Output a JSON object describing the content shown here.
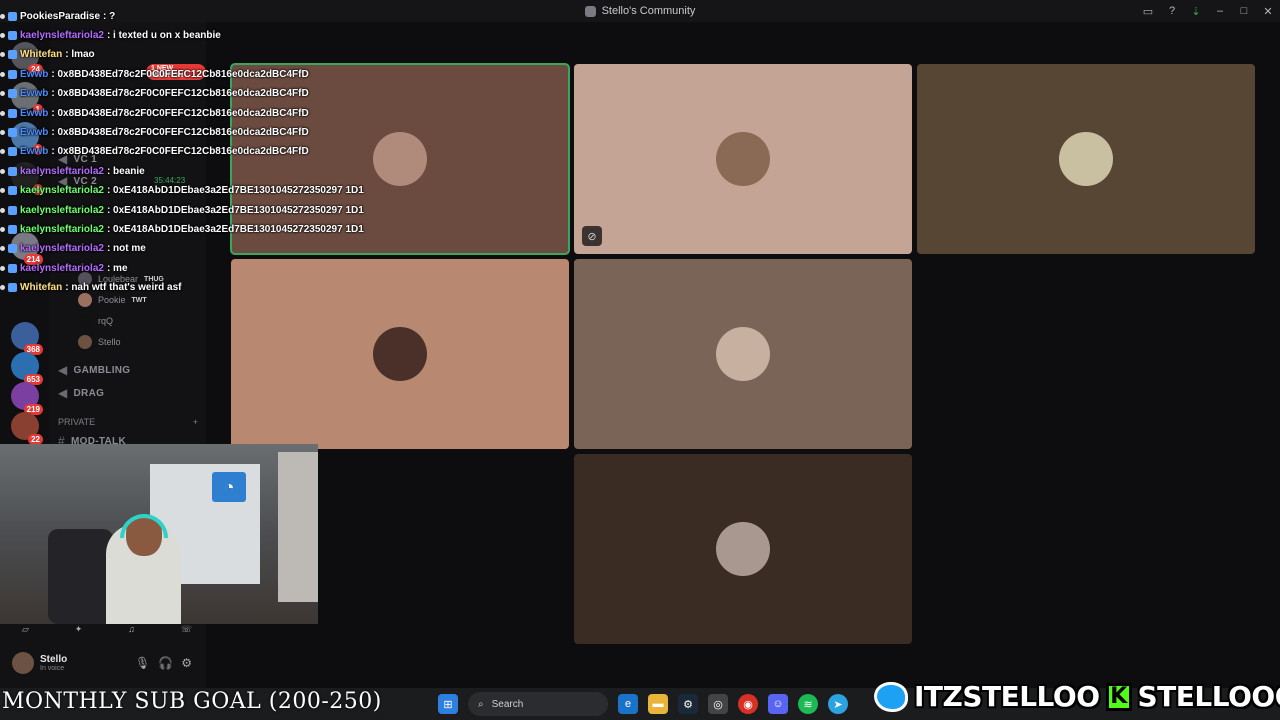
{
  "window": {
    "title": "Stello's Community"
  },
  "server_badges": [
    "24",
    "1",
    "1",
    "4",
    "214",
    "368",
    "653",
    "219",
    "22"
  ],
  "sidebar": {
    "new_mention": "1 NEW MENTION",
    "timer": "35:44:23",
    "channels": {
      "vc1": "VC 1",
      "vc2": "VC 2",
      "gambling": "GAMBLING",
      "drag": "DRAG",
      "mod_talk": "MOD-TALK"
    },
    "voice_users": [
      {
        "name": "Loulebear",
        "tag": "THUG"
      },
      {
        "name": "Pookie",
        "tag": "TWT"
      },
      {
        "name": "rqQ",
        "tag": ""
      },
      {
        "name": "Stello",
        "tag": ""
      }
    ],
    "private_label": "PRIVATE",
    "private_add": "+"
  },
  "chat": [
    {
      "user": "PookiesParadise",
      "color": "#ffffff",
      "text": ": ?"
    },
    {
      "user": "kaelynsleftariola2",
      "color": "#b46cff",
      "text": ": i texted u on x beanbie"
    },
    {
      "user": "Whitefan",
      "color": "#ffe082",
      "text": ": lmao"
    },
    {
      "user": "Ewwb",
      "color": "#4b8bff",
      "text": ": 0x8BD438Ed78c2F0C0FEFC12Cb816e0dca2dBC4FfD"
    },
    {
      "user": "Ewwb",
      "color": "#4b8bff",
      "text": ": 0x8BD438Ed78c2F0C0FEFC12Cb816e0dca2dBC4FfD"
    },
    {
      "user": "Ewwb",
      "color": "#4b8bff",
      "text": ": 0x8BD438Ed78c2F0C0FEFC12Cb816e0dca2dBC4FfD"
    },
    {
      "user": "Ewwb",
      "color": "#4b8bff",
      "text": ": 0x8BD438Ed78c2F0C0FEFC12Cb816e0dca2dBC4FfD"
    },
    {
      "user": "Ewwb",
      "color": "#4b8bff",
      "text": ": 0x8BD438Ed78c2F0C0FEFC12Cb816e0dca2dBC4FfD"
    },
    {
      "user": "kaelynsleftariola2",
      "color": "#b46cff",
      "text": ": beanie"
    },
    {
      "user": "kaelynsleftariola2",
      "color": "#6cff6c",
      "text": ": 0xE418AbD1DEbae3a2Ed7BE1301045272350297 1D1"
    },
    {
      "user": "kaelynsleftariola2",
      "color": "#6cff6c",
      "text": ": 0xE418AbD1DEbae3a2Ed7BE1301045272350297 1D1"
    },
    {
      "user": "kaelynsleftariola2",
      "color": "#6cff6c",
      "text": ": 0xE418AbD1DEbae3a2Ed7BE1301045272350297 1D1"
    },
    {
      "user": "kaelynsleftariola2",
      "color": "#b46cff",
      "text": ": not me"
    },
    {
      "user": "kaelynsleftariola2",
      "color": "#b46cff",
      "text": ": me"
    },
    {
      "user": "Whitefan",
      "color": "#ffe082",
      "text": ": nah wtf that's weird asf"
    }
  ],
  "tiles": [
    {
      "bg": "#6b4a3f",
      "pfp": "#b08a7a",
      "active": true
    },
    {
      "bg": "#c4a595",
      "pfp": "#8a6a55",
      "muted": true
    },
    {
      "bg": "#584634",
      "pfp": "#c8c0a0"
    },
    {
      "bg": "#b88870",
      "pfp": "#4a3028"
    },
    {
      "bg": "#7a6458",
      "pfp": "#c8b0a0"
    },
    {
      "bg": "#3a2c22",
      "pfp": "#a89890"
    }
  ],
  "user_panel": {
    "name": "Stello",
    "status": "In voice"
  },
  "overlay": {
    "sub_goal": "MONTHLY SUB GOAL (200-250)",
    "twitter": "ITZSTELLOO",
    "kick": "STELLOOO",
    "kick_logo": "K"
  },
  "taskbar": {
    "search_placeholder": "Search"
  }
}
